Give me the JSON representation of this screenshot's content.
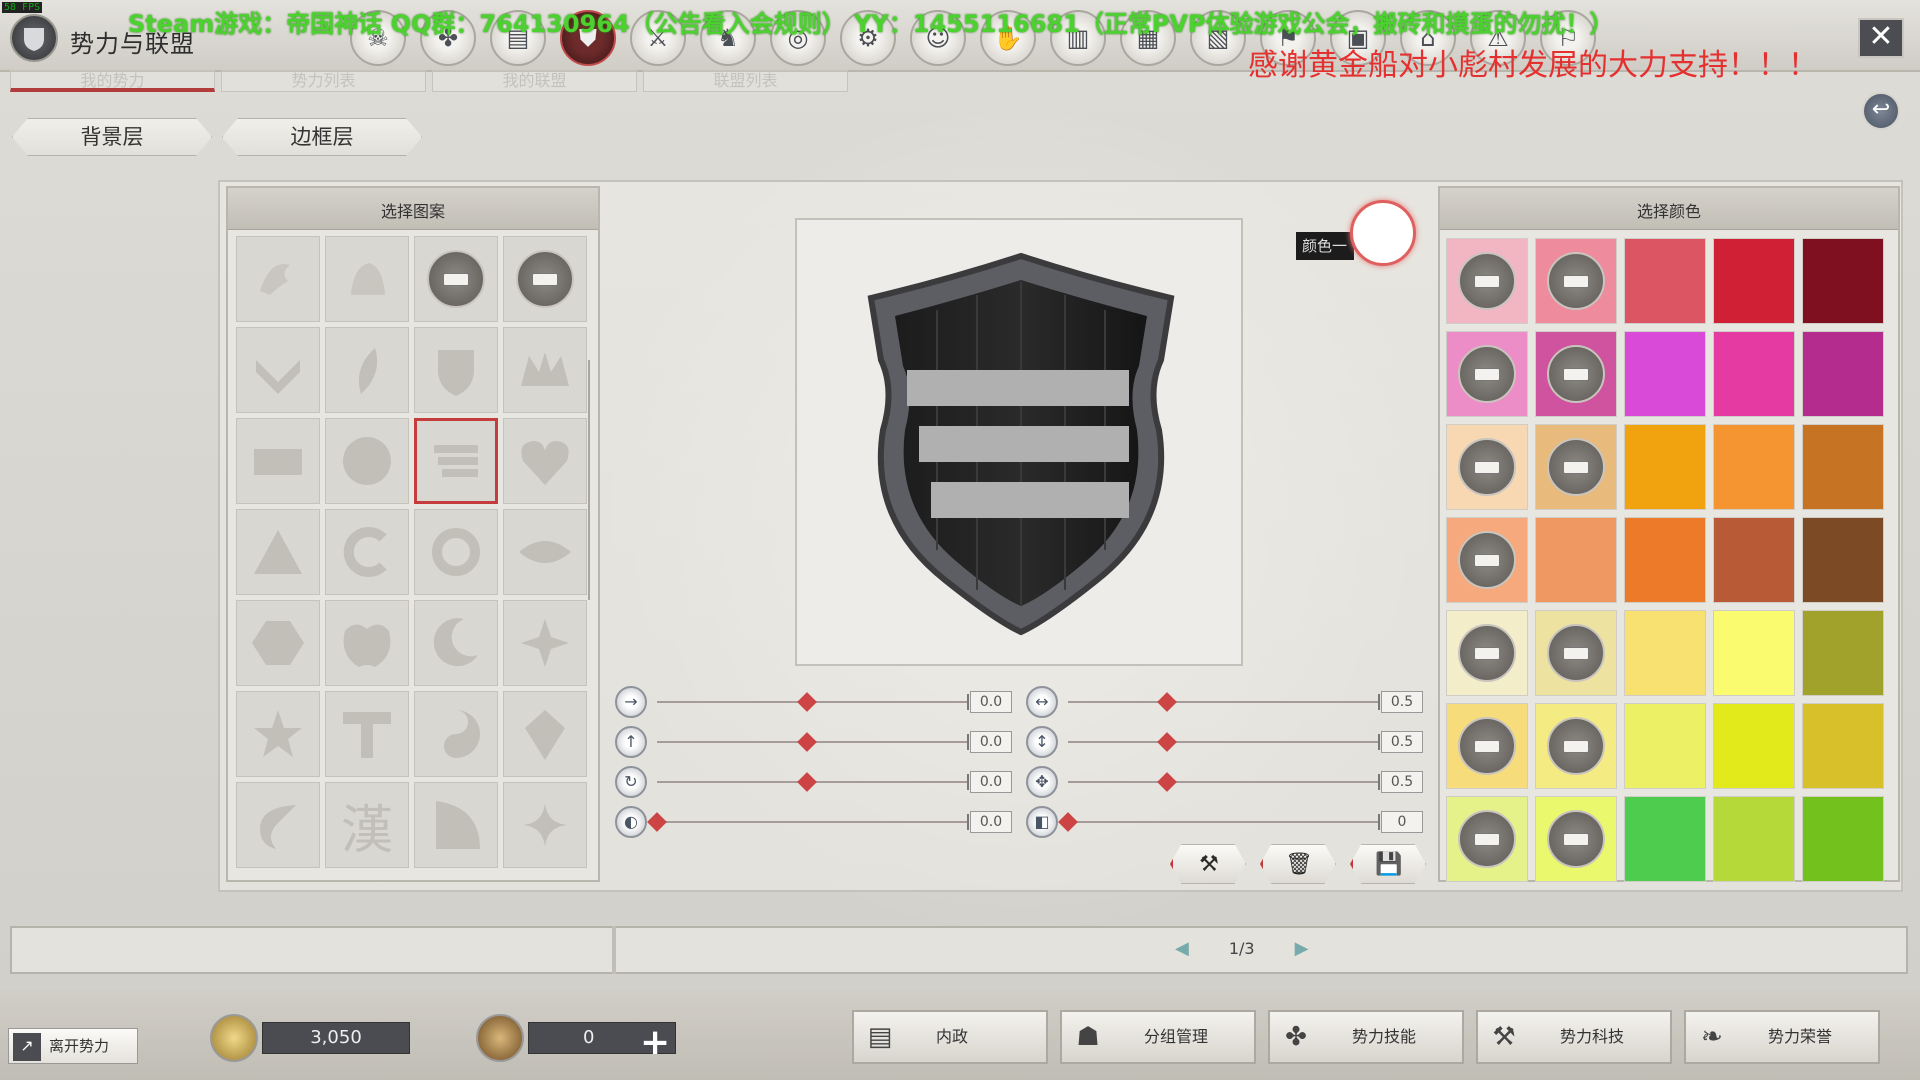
{
  "fps": "58 FPS",
  "header": {
    "title": "势力与联盟",
    "marquee": "Steam游戏：帝国神话 QQ群：764130964（公告看入会规则） YY：1455116681（正常PVP体验游戏公会，搬砖和摸蛋的勿扰！）",
    "thanks": "感谢黄金船对小彪村发展的大力支持！！！",
    "close_label": "✕",
    "back_label": "↩"
  },
  "top_icons": [
    "scroll-icon",
    "network-icon",
    "book-icon",
    "shield-icon",
    "sword-icon",
    "helmet-icon",
    "target-icon",
    "gear-icon",
    "mask-icon",
    "hand-icon",
    "bag-icon",
    "map-icon",
    "fan-icon",
    "tower-icon",
    "chest-icon",
    "castle-icon",
    "temple-icon",
    "flag-icon"
  ],
  "top_icon_glyphs": [
    "☠",
    "✤",
    "▤",
    "⛊",
    "⚔",
    "♞",
    "◎",
    "⚙",
    "☺",
    "✋",
    "▥",
    "▦",
    "▧",
    "⚑",
    "▣",
    "⌂",
    "⚠",
    "⚐"
  ],
  "sub_tabs": [
    "我的势力",
    "势力列表",
    "我的联盟",
    "联盟列表"
  ],
  "layer_tabs": [
    "背景层",
    "边框层"
  ],
  "pattern_panel": {
    "title": "选择图案",
    "items": [
      "dragon",
      "beast",
      "locked",
      "locked",
      "chevron",
      "feather",
      "shield",
      "crown",
      "rectangle",
      "circle",
      "three-bars",
      "heart",
      "triangle",
      "c-letter",
      "ring",
      "eye",
      "hexagon",
      "apple",
      "crescent",
      "star4",
      "star",
      "t-letter",
      "yinyang",
      "spade",
      "hook",
      "han-character",
      "quarter",
      "sparkle"
    ],
    "han_char": "漢"
  },
  "color_panel": {
    "title": "选择颜色",
    "cells": [
      {
        "c": "#f2b5c2",
        "locked": true
      },
      {
        "c": "#ee8c9e",
        "locked": true
      },
      {
        "c": "#db5563"
      },
      {
        "c": "#cf2035"
      },
      {
        "c": "#7e1020"
      },
      {
        "c": "#ed8dc8",
        "locked": true
      },
      {
        "c": "#d0539f",
        "locked": true
      },
      {
        "c": "#d94ad9"
      },
      {
        "c": "#e43aa2"
      },
      {
        "c": "#b42c8d"
      },
      {
        "c": "#f7d8b2",
        "locked": true
      },
      {
        "c": "#e8ba7c",
        "locked": true
      },
      {
        "c": "#f0a20f"
      },
      {
        "c": "#f49532"
      },
      {
        "c": "#c67424"
      },
      {
        "c": "#f5a97c",
        "locked": true
      },
      {
        "c": "#f09862"
      },
      {
        "c": "#ec7a29"
      },
      {
        "c": "#b85a36"
      },
      {
        "c": "#7c4a25"
      },
      {
        "c": "#f3edca",
        "locked": true
      },
      {
        "c": "#eee2a0",
        "locked": true
      },
      {
        "c": "#f8e170"
      },
      {
        "c": "#fbfb70"
      },
      {
        "c": "#a1a22c"
      },
      {
        "c": "#f7dc7c",
        "locked": true
      },
      {
        "c": "#f4ec82",
        "locked": true
      },
      {
        "c": "#ebf064"
      },
      {
        "c": "#e3ea1c"
      },
      {
        "c": "#d8c02b"
      },
      {
        "c": "#e5f28a",
        "locked": true
      },
      {
        "c": "#e9f86c",
        "locked": true
      },
      {
        "c": "#4dcc4d"
      },
      {
        "c": "#b6d93a"
      },
      {
        "c": "#72c11d"
      }
    ]
  },
  "color_slot_label": "颜色一",
  "sliders_left": [
    {
      "icon": "→",
      "value": "0.0",
      "fraction": 0.5
    },
    {
      "icon": "↑",
      "value": "0.0",
      "fraction": 0.5
    },
    {
      "icon": "↻",
      "value": "0.0",
      "fraction": 0.5
    },
    {
      "icon": "◐",
      "value": "0.0",
      "fraction": 0.0
    }
  ],
  "sliders_right": [
    {
      "icon": "↔",
      "value": "0.5",
      "fraction": 0.33
    },
    {
      "icon": "↕",
      "value": "0.5",
      "fraction": 0.33
    },
    {
      "icon": "✥",
      "value": "0.5",
      "fraction": 0.33
    },
    {
      "icon": "◧",
      "value": "0",
      "fraction": 0.0
    }
  ],
  "actions": [
    {
      "name": "apply-button",
      "icon": "⚒"
    },
    {
      "name": "delete-button",
      "icon": "🗑"
    },
    {
      "name": "save-button",
      "icon": "💾"
    }
  ],
  "pager": {
    "prev": "◀",
    "page": "1/3",
    "next": "▶"
  },
  "footer": {
    "leave_label": "离开势力",
    "leave_icon": "↗",
    "coins": "3,050",
    "resource": "0",
    "plus": "+",
    "nav": [
      {
        "label": "内政",
        "icon": "▤"
      },
      {
        "label": "分组管理",
        "icon": "☗"
      },
      {
        "label": "势力技能",
        "icon": "✤"
      },
      {
        "label": "势力科技",
        "icon": "⚒"
      },
      {
        "label": "势力荣誉",
        "icon": "❧"
      }
    ]
  }
}
